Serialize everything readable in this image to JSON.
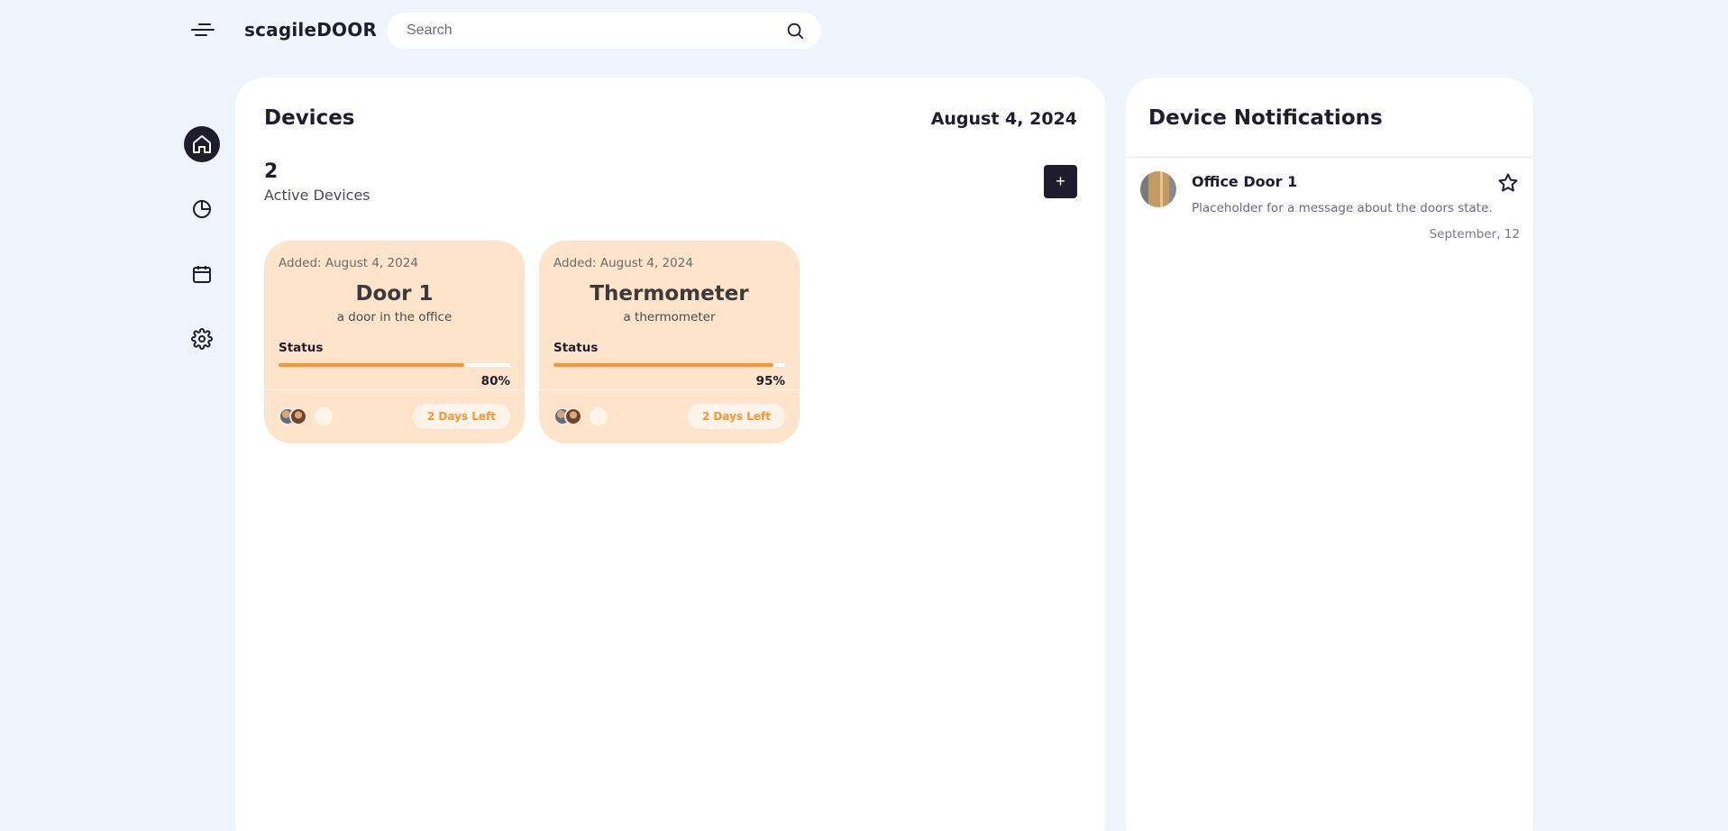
{
  "app": {
    "title": "scagileDOOR"
  },
  "search": {
    "placeholder": "Search"
  },
  "sidebar": {
    "items": [
      {
        "name": "home",
        "icon": "home-icon",
        "active": true
      },
      {
        "name": "statistics",
        "icon": "pie-chart-icon",
        "active": false
      },
      {
        "name": "calendar",
        "icon": "calendar-icon",
        "active": false
      },
      {
        "name": "settings",
        "icon": "gear-icon",
        "active": false
      }
    ]
  },
  "devices": {
    "title": "Devices",
    "date": "August 4, 2024",
    "active_count": "2",
    "active_label": "Active Devices",
    "add_label": "+",
    "cards": [
      {
        "added": "Added: August 4, 2024",
        "title": "Door 1",
        "subtitle": "a door in the office",
        "status_label": "Status",
        "progress": 80,
        "progress_label": "80%",
        "days_left": "2 Days Left"
      },
      {
        "added": "Added: August 4, 2024",
        "title": "Thermometer",
        "subtitle": "a thermometer",
        "status_label": "Status",
        "progress": 95,
        "progress_label": "95%",
        "days_left": "2 Days Left"
      }
    ]
  },
  "notifications": {
    "title": "Device Notifications",
    "items": [
      {
        "name": "Office Door 1",
        "message": "Placeholder for a message about the doors state.",
        "date": "September, 12",
        "icon": "star-icon"
      }
    ]
  },
  "colors": {
    "background": "#f0f4fc",
    "card": "#fee4cb",
    "accent": "#ff942e",
    "dark": "#1f1c2e"
  }
}
